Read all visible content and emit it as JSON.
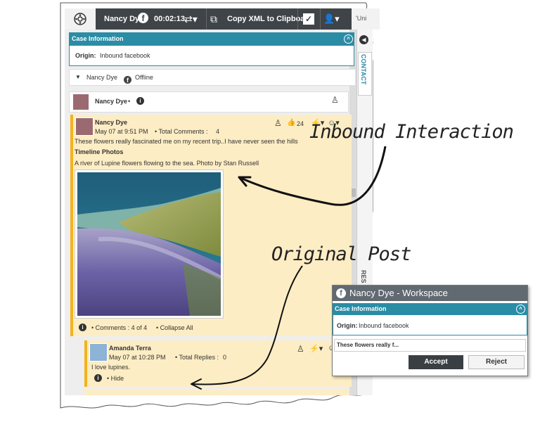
{
  "toolbar": {
    "contact_name": "Nancy Dye",
    "timer": "00:02:13",
    "copy_xml_label": "Copy XML to Clipboard",
    "next_tab_label": "'Uni"
  },
  "case_info": {
    "header": "Case Information",
    "origin_label": "Origin:",
    "origin_value": "Inbound facebook"
  },
  "contact_status": {
    "name": "Nancy Dye",
    "status": "Offline"
  },
  "side_tabs": {
    "contact": "CONTACT",
    "res": "RES"
  },
  "page_header": {
    "name": "Nancy Dye"
  },
  "post": {
    "author": "Nancy Dye",
    "date": "May 07 at 9:51 PM",
    "total_comments_label": "• Total Comments :",
    "total_comments": "4",
    "likes": "24",
    "text": "These flowers really fascinated me on my recent trip..I have never seen the hills so purple :)",
    "album": "Timeline Photos",
    "caption": "A river of Lupine flowers flowing to the sea. Photo by Stan Russell",
    "comments_status": "• Comments :  4 of 4",
    "collapse_all": "• Collapse All"
  },
  "comment": {
    "author": "Amanda Terra",
    "date": "May 07 at 10:28 PM",
    "total_replies_label": "• Total Replies :",
    "total_replies": "0",
    "text": "I love lupines.",
    "hide": "• Hide"
  },
  "annotations": {
    "inbound": "Inbound Interaction",
    "original": "Original Post"
  },
  "popup": {
    "title": "Nancy Dye - Workspace",
    "case_header": "Case Information",
    "origin_label": "Origin:",
    "origin_value": "Inbound facebook",
    "preview": "These flowers really f...",
    "accept": "Accept",
    "reject": "Reject"
  },
  "colors": {
    "toolbar": "#3f4448",
    "teal": "#2b8ca5",
    "post_bg": "#fdedc4",
    "post_accent": "#f5b21b",
    "popup_title": "#616971",
    "accept_bg": "#3a3f44"
  }
}
